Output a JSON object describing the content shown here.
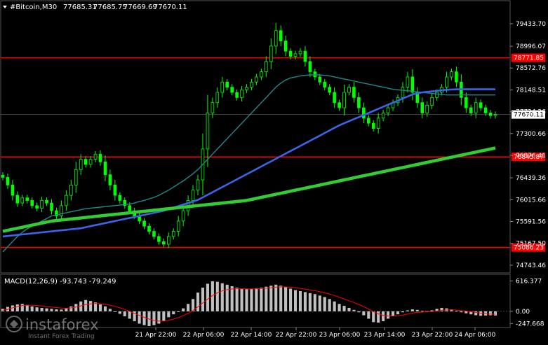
{
  "header": {
    "symbol": "#Bitcoin,M30",
    "open": "77685.31",
    "high": "77685.75",
    "low": "77669.69",
    "close": "77670.11"
  },
  "macd": {
    "label": "MACD(12,26,9) -93.743 -79.249",
    "ticks": [
      "616.377",
      "0.00",
      "-247.668"
    ]
  },
  "watermark": {
    "brand": "instaforex",
    "sub": "Instant Forex Trading"
  },
  "colors": {
    "background": "#000000",
    "candle": "#00ff00",
    "ma_slow": "#32cd32",
    "ma_mid": "#3c64e6",
    "ma_fast": "#1f8a8a",
    "level": "#ff0000",
    "macd_hist": "#c0c0c0",
    "macd_signal": "#ff0000"
  },
  "chart_data": [
    {
      "type": "candlestick",
      "title": "#Bitcoin,M30",
      "x_ticks": [
        "21 Apr 22:00",
        "22 Apr 06:00",
        "22 Apr 14:00",
        "22 Apr 22:00",
        "23 Apr 06:00",
        "23 Apr 14:00",
        "23 Apr 22:00",
        "24 Apr 06:00"
      ],
      "y_ticks": [
        79433.7,
        78996.07,
        78572.76,
        78148.51,
        77724.26,
        77300.66,
        76876.41,
        76439.36,
        76015.66,
        75591.56,
        75167.5,
        74743.46
      ],
      "ylim": [
        74660,
        79650
      ],
      "levels": [
        {
          "value": 78771.85,
          "label": "78771.85"
        },
        {
          "value": 76845.87,
          "label": "76845.87"
        },
        {
          "value": 75086.23,
          "label": "75086.23"
        }
      ],
      "current_price": {
        "value": 77670.11,
        "label": "77670.11"
      },
      "series": [
        {
          "key": "close",
          "values": [
            76450,
            76300,
            76100,
            75950,
            76050,
            76000,
            75900,
            75850,
            76000,
            75950,
            75800,
            75700,
            75900,
            76100,
            76300,
            76600,
            76800,
            76700,
            76800,
            76900,
            76750,
            76500,
            76300,
            76100,
            76000,
            75900,
            75800,
            75700,
            75600,
            75500,
            75400,
            75300,
            75200,
            75150,
            75300,
            75400,
            75600,
            75800,
            76000,
            76200,
            76400,
            77000,
            77700,
            77900,
            78100,
            78300,
            78200,
            78100,
            78000,
            78150,
            78200,
            78300,
            78400,
            78500,
            78700,
            79000,
            79300,
            79100,
            78900,
            78800,
            78850,
            78900,
            78700,
            78500,
            78400,
            78300,
            78200,
            78100,
            77900,
            77800,
            78100,
            78200,
            78000,
            77800,
            77600,
            77500,
            77400,
            77600,
            77700,
            77800,
            77900,
            78000,
            78200,
            78400,
            78100,
            77900,
            77700,
            77850,
            78000,
            78100,
            78200,
            78400,
            78500,
            78300,
            78000,
            77800,
            77700,
            77900,
            77800,
            77700,
            77650,
            77670
          ]
        },
        {
          "key": "ma_slow",
          "name": "",
          "values": [
            75400,
            75420,
            75440,
            75460,
            75480,
            75500,
            75520,
            75540,
            75560,
            75580,
            75600,
            75610,
            75620,
            75630,
            75640,
            75650,
            75660,
            75670,
            75680,
            75690,
            75700,
            75710,
            75720,
            75730,
            75740,
            75750,
            75760,
            75770,
            75780,
            75790,
            75800,
            75810,
            75820,
            75830,
            75840,
            75850,
            75860,
            75870,
            75880,
            75890,
            75900,
            75910,
            75920,
            75930,
            75940,
            75950,
            75960,
            75970,
            75980,
            75990,
            76000,
            76020,
            76040,
            76060,
            76080,
            76100,
            76120,
            76140,
            76160,
            76180,
            76200,
            76220,
            76240,
            76260,
            76280,
            76300,
            76320,
            76340,
            76360,
            76380,
            76400,
            76420,
            76440,
            76460,
            76480,
            76500,
            76520,
            76540,
            76560,
            76580,
            76600,
            76620,
            76640,
            76660,
            76680,
            76700,
            76720,
            76740,
            76760,
            76780,
            76800,
            76820,
            76840,
            76860,
            76880,
            76900,
            76920,
            76940,
            76960,
            76980,
            77000,
            77020
          ]
        },
        {
          "key": "ma_mid",
          "name": "",
          "values": [
            75300,
            75310,
            75320,
            75330,
            75340,
            75350,
            75360,
            75370,
            75380,
            75390,
            75400,
            75410,
            75420,
            75430,
            75440,
            75450,
            75460,
            75480,
            75500,
            75520,
            75540,
            75560,
            75580,
            75600,
            75620,
            75640,
            75660,
            75680,
            75700,
            75720,
            75740,
            75760,
            75780,
            75800,
            75830,
            75860,
            75890,
            75920,
            75950,
            75980,
            76010,
            76060,
            76110,
            76160,
            76210,
            76260,
            76310,
            76360,
            76410,
            76460,
            76510,
            76560,
            76610,
            76660,
            76710,
            76760,
            76810,
            76860,
            76910,
            76960,
            77010,
            77060,
            77110,
            77160,
            77210,
            77260,
            77310,
            77360,
            77410,
            77460,
            77500,
            77540,
            77580,
            77620,
            77660,
            77700,
            77740,
            77780,
            77820,
            77860,
            77900,
            77940,
            77980,
            78020,
            78060,
            78080,
            78100,
            78110,
            78120,
            78130,
            78140,
            78150,
            78155,
            78160,
            78160,
            78160,
            78160,
            78160,
            78160,
            78160,
            78160,
            78160
          ]
        },
        {
          "key": "ma_fast",
          "name": "",
          "values": [
            75000,
            75100,
            75200,
            75300,
            75380,
            75450,
            75500,
            75550,
            75600,
            75650,
            75700,
            75720,
            75740,
            75760,
            75780,
            75800,
            75820,
            75840,
            75850,
            75860,
            75870,
            75880,
            75890,
            75900,
            75910,
            75920,
            75930,
            75950,
            75980,
            76000,
            76030,
            76060,
            76100,
            76150,
            76200,
            76260,
            76320,
            76380,
            76450,
            76520,
            76600,
            76700,
            76800,
            76900,
            77000,
            77100,
            77200,
            77300,
            77400,
            77500,
            77600,
            77700,
            77800,
            77900,
            78000,
            78100,
            78200,
            78280,
            78340,
            78380,
            78400,
            78420,
            78430,
            78440,
            78440,
            78440,
            78430,
            78420,
            78400,
            78380,
            78360,
            78340,
            78320,
            78300,
            78280,
            78260,
            78240,
            78220,
            78200,
            78180,
            78160,
            78150,
            78140,
            78130,
            78120,
            78110,
            78100,
            78090,
            78080,
            78070,
            78060,
            78050,
            78050,
            78050,
            78050,
            78050,
            78050,
            78050,
            78050,
            78050,
            78050,
            78050
          ]
        }
      ]
    },
    {
      "type": "bar",
      "title": "MACD(12,26,9) -93.743 -79.249",
      "ylim": [
        -300,
        680
      ],
      "series": [
        {
          "key": "histogram",
          "values": [
            50,
            90,
            120,
            140,
            150,
            130,
            100,
            80,
            70,
            60,
            50,
            40,
            35,
            60,
            100,
            150,
            200,
            230,
            210,
            180,
            140,
            100,
            50,
            0,
            -50,
            -100,
            -150,
            -200,
            -250,
            -280,
            -300,
            -280,
            -250,
            -200,
            -120,
            -60,
            0,
            60,
            150,
            250,
            380,
            480,
            560,
            610,
            600,
            570,
            540,
            510,
            480,
            460,
            450,
            460,
            470,
            480,
            500,
            520,
            540,
            520,
            490,
            460,
            430,
            410,
            390,
            370,
            350,
            320,
            290,
            250,
            200,
            150,
            110,
            70,
            30,
            -20,
            -80,
            -150,
            -220,
            -230,
            -200,
            -150,
            -100,
            -60,
            -20,
            20,
            40,
            30,
            10,
            0,
            20,
            50,
            70,
            60,
            40,
            10,
            -20,
            -40,
            -60,
            -80,
            -90,
            -85,
            -80,
            -85
          ]
        },
        {
          "key": "signal",
          "name": "",
          "values": [
            20,
            40,
            70,
            95,
            115,
            125,
            125,
            118,
            108,
            96,
            86,
            76,
            66,
            63,
            71,
            87,
            110,
            135,
            152,
            160,
            156,
            145,
            126,
            101,
            71,
            37,
            -1,
            -41,
            -83,
            -122,
            -158,
            -182,
            -196,
            -197,
            -182,
            -158,
            -126,
            -89,
            -41,
            17,
            90,
            168,
            247,
            320,
            376,
            415,
            440,
            454,
            459,
            459,
            457,
            457,
            459,
            463,
            470,
            480,
            492,
            497,
            496,
            489,
            478,
            466,
            451,
            435,
            418,
            398,
            376,
            351,
            320,
            286,
            251,
            215,
            178,
            138,
            94,
            45,
            -8,
            -52,
            -80,
            -94,
            -95,
            -88,
            -74,
            -55,
            -36,
            -23,
            -16,
            -13,
            -6,
            6,
            19,
            27,
            29,
            25,
            16,
            5,
            -8,
            -22,
            -36,
            -47,
            -54,
            -59
          ]
        }
      ]
    }
  ]
}
